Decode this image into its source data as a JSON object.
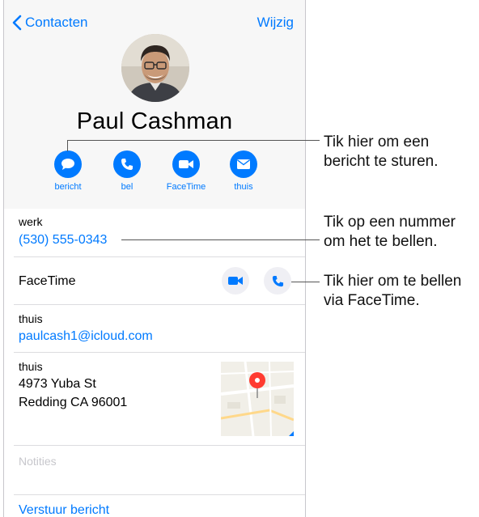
{
  "nav": {
    "back_label": "Contacten",
    "edit_label": "Wijzig"
  },
  "contact": {
    "name": "Paul Cashman"
  },
  "actions": [
    {
      "label": "bericht",
      "icon": "message-icon"
    },
    {
      "label": "bel",
      "icon": "phone-icon"
    },
    {
      "label": "FaceTime",
      "icon": "video-icon"
    },
    {
      "label": "thuis",
      "icon": "mail-icon"
    }
  ],
  "fields": {
    "phone": {
      "label": "werk",
      "value": "(530) 555-0343"
    },
    "facetime": {
      "label": "FaceTime"
    },
    "email": {
      "label": "thuis",
      "value": "paulcash1@icloud.com"
    },
    "address": {
      "label": "thuis",
      "line1": "4973 Yuba St",
      "line2": "Redding CA 96001"
    },
    "notes_placeholder": "Notities",
    "send_message": "Verstuur bericht"
  },
  "callouts": {
    "message": [
      "Tik hier om een",
      "bericht te sturen."
    ],
    "number": [
      "Tik op een nummer",
      "om het te bellen."
    ],
    "facetime": [
      "Tik hier om te bellen",
      "via FaceTime."
    ]
  },
  "colors": {
    "accent": "#007aff",
    "header_bg": "#f7f7f7",
    "separator": "#dcdcdf",
    "pin": "#ff3b30"
  }
}
